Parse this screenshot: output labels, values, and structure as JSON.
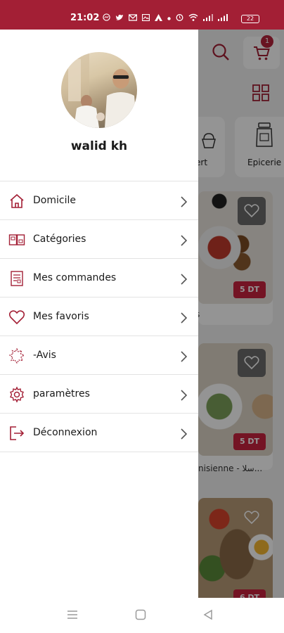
{
  "status_bar": {
    "time": "21:02",
    "battery": "22",
    "icons": [
      "messenger-icon",
      "twitter-icon",
      "gmail-icon",
      "gallery-icon",
      "app-icon",
      "dot",
      "alarm-icon",
      "wifi-icon",
      "signal-icon",
      "signal-icon"
    ]
  },
  "drawer": {
    "user_name": "walid kh",
    "menu": [
      {
        "label": "Domicile",
        "icon": "home-icon"
      },
      {
        "label": "Catégories",
        "icon": "categories-icon"
      },
      {
        "label": "Mes commandes",
        "icon": "orders-icon"
      },
      {
        "label": "Mes favoris",
        "icon": "heart-icon"
      },
      {
        "label": "-Avis",
        "icon": "review-icon"
      },
      {
        "label": "paramètres",
        "icon": "settings-icon"
      },
      {
        "label": "Déconnexion",
        "icon": "logout-icon"
      }
    ]
  },
  "background": {
    "cart_count": "1",
    "categories": [
      "ert",
      "Epicerie"
    ],
    "foods": [
      {
        "price": "5 DT",
        "caption": "s"
      },
      {
        "price": "5 DT",
        "caption": "nisienne - سلا..."
      },
      {
        "price": "6 DT",
        "caption": ""
      }
    ]
  },
  "colors": {
    "accent": "#a31f35",
    "price_tag": "#c9243f"
  }
}
